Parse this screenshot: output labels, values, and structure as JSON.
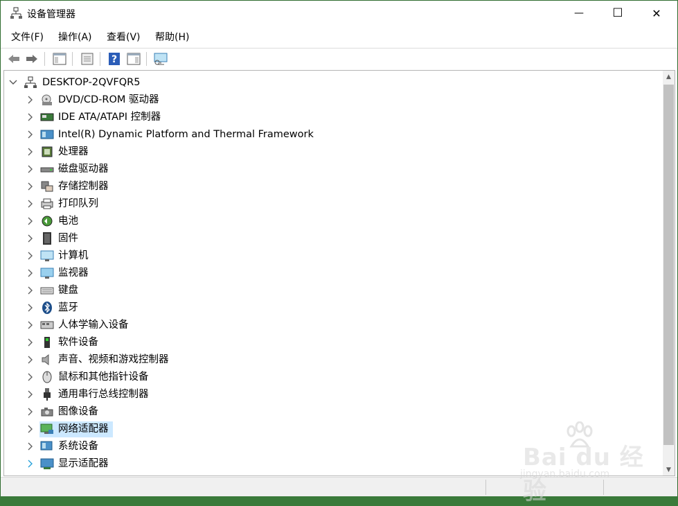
{
  "window": {
    "title": "设备管理器",
    "minimize": "—",
    "maximize": "☐",
    "close": "✕"
  },
  "menu": [
    {
      "label": "文件(F)"
    },
    {
      "label": "操作(A)"
    },
    {
      "label": "查看(V)"
    },
    {
      "label": "帮助(H)"
    }
  ],
  "toolbar": [
    {
      "icon": "back-arrow-icon"
    },
    {
      "icon": "forward-arrow-icon"
    },
    {
      "icon": "show-hide-console-tree-icon"
    },
    {
      "icon": "properties-icon"
    },
    {
      "icon": "help-icon"
    },
    {
      "icon": "action-pane-icon"
    },
    {
      "icon": "monitor-scan-icon"
    }
  ],
  "tree": {
    "root": {
      "label": "DESKTOP-2QVFQR5",
      "expanded": true,
      "icon": "computer-network-icon"
    },
    "items": [
      {
        "label": "DVD/CD-ROM 驱动器",
        "icon": "dvd-drive-icon"
      },
      {
        "label": "IDE ATA/ATAPI 控制器",
        "icon": "ide-controller-icon"
      },
      {
        "label": "Intel(R) Dynamic Platform and Thermal Framework",
        "icon": "intel-thermal-icon"
      },
      {
        "label": "处理器",
        "icon": "processor-icon"
      },
      {
        "label": "磁盘驱动器",
        "icon": "disk-drive-icon"
      },
      {
        "label": "存储控制器",
        "icon": "storage-controller-icon"
      },
      {
        "label": "打印队列",
        "icon": "printer-icon"
      },
      {
        "label": "电池",
        "icon": "battery-icon"
      },
      {
        "label": "固件",
        "icon": "firmware-icon"
      },
      {
        "label": "计算机",
        "icon": "computer-icon"
      },
      {
        "label": "监视器",
        "icon": "monitor-icon"
      },
      {
        "label": "键盘",
        "icon": "keyboard-icon"
      },
      {
        "label": "蓝牙",
        "icon": "bluetooth-icon"
      },
      {
        "label": "人体学输入设备",
        "icon": "hid-icon"
      },
      {
        "label": "软件设备",
        "icon": "software-device-icon"
      },
      {
        "label": "声音、视频和游戏控制器",
        "icon": "speaker-icon"
      },
      {
        "label": "鼠标和其他指针设备",
        "icon": "mouse-icon"
      },
      {
        "label": "通用串行总线控制器",
        "icon": "usb-icon"
      },
      {
        "label": "图像设备",
        "icon": "camera-icon"
      },
      {
        "label": "网络适配器",
        "icon": "network-adapter-icon",
        "selected": true
      },
      {
        "label": "系统设备",
        "icon": "system-device-icon"
      },
      {
        "label": "显示适配器",
        "icon": "display-adapter-icon",
        "hover": true
      }
    ]
  },
  "watermark": {
    "brand": "Bai du 经验",
    "url": "jingyan.baidu.com"
  },
  "colors": {
    "selection": "#cce8ff",
    "chevron": "#606060",
    "chevron_hover": "#26a0da"
  }
}
